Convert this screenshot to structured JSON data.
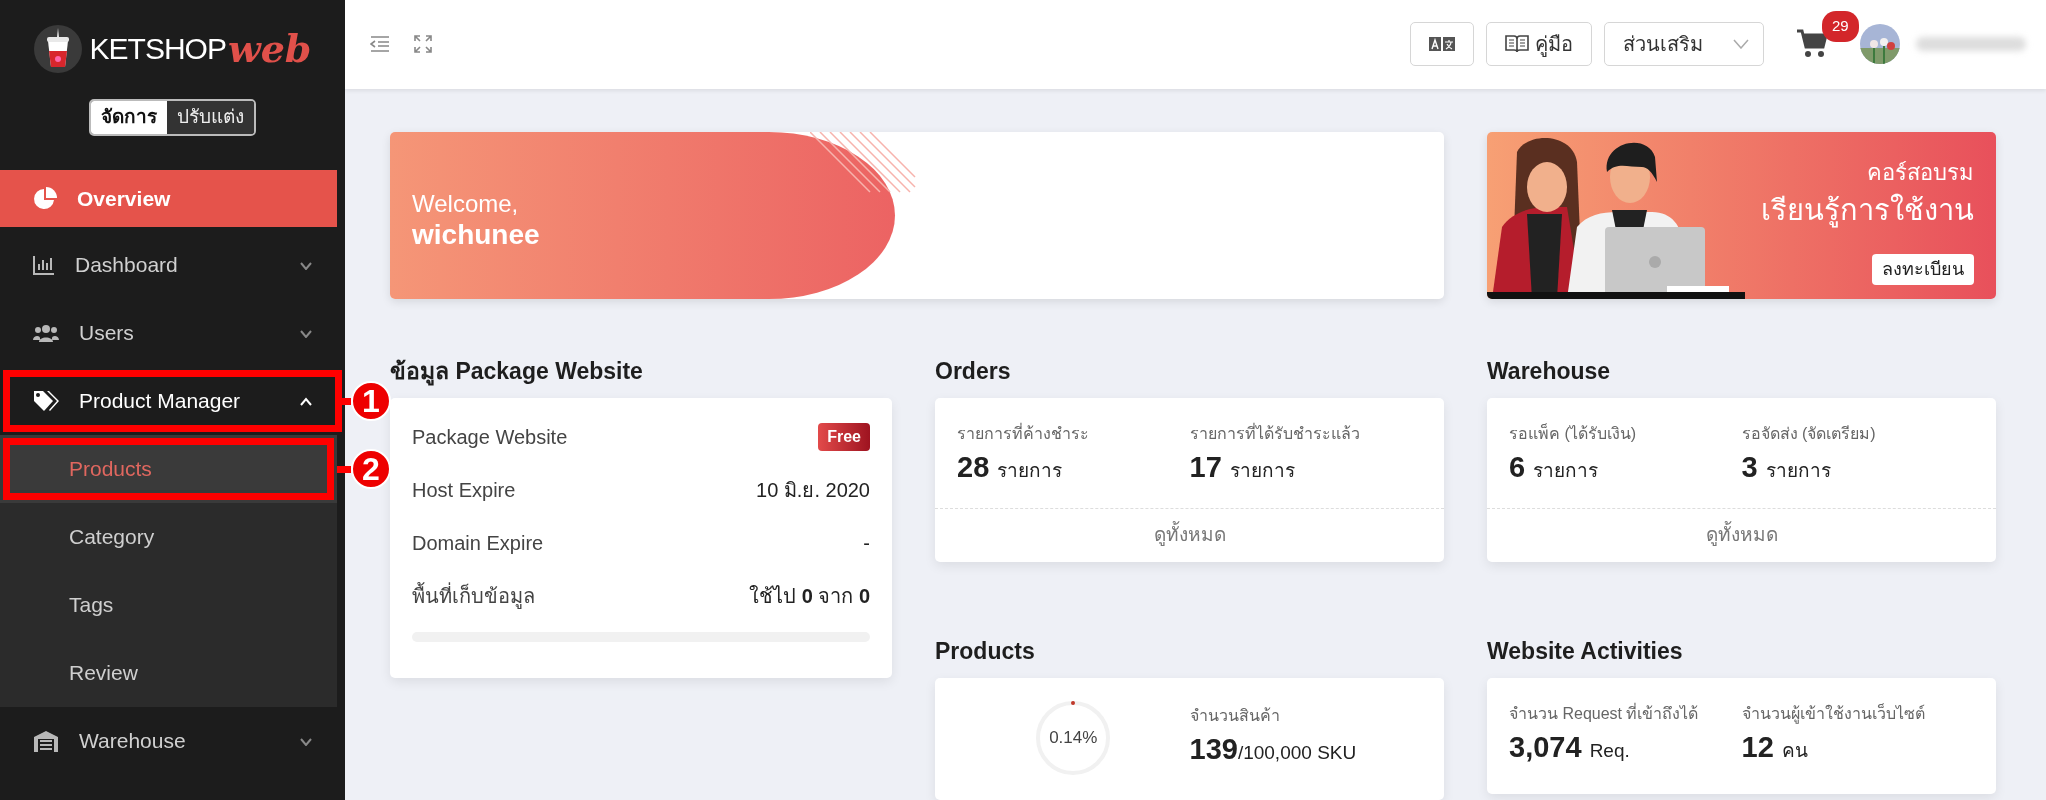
{
  "brand": {
    "name": "KETSHOP",
    "suffix": "web"
  },
  "mode_toggle": [
    {
      "label": "จัดการ",
      "selected": true
    },
    {
      "label": "ปรับแต่ง",
      "selected": false
    }
  ],
  "sidebar": {
    "items": [
      {
        "label": "Overview",
        "kind": "link",
        "selected": true
      },
      {
        "label": "Dashboard",
        "kind": "group",
        "selected": false,
        "expanded": false
      },
      {
        "label": "Users",
        "kind": "group",
        "selected": false,
        "expanded": false
      },
      {
        "label": "Product Manager",
        "kind": "group",
        "selected": false,
        "expanded": true,
        "callout": "1",
        "children": [
          {
            "label": "Products",
            "selected": true,
            "callout": "2"
          },
          {
            "label": "Category",
            "selected": false
          },
          {
            "label": "Tags",
            "selected": false
          },
          {
            "label": "Review",
            "selected": false
          }
        ]
      },
      {
        "label": "Warehouse",
        "kind": "group",
        "selected": false,
        "expanded": false
      }
    ]
  },
  "topbar": {
    "manual_button": "คู่มือ",
    "addons_dropdown": "ส่วนเสริม",
    "cart_count": "29"
  },
  "welcome": {
    "greeting": "Welcome,",
    "name": "wichunee"
  },
  "course_banner": {
    "subtitle": "คอร์สอบรม",
    "title": "เรียนรู้การใช้งาน",
    "button": "ลงทะเบียน"
  },
  "package": {
    "title": "ข้อมูล Package Website",
    "rows": [
      {
        "kind": "badge",
        "label": "Package Website",
        "value": "Free"
      },
      {
        "kind": "text",
        "label": "Host Expire",
        "value": "10 มิ.ย. 2020"
      },
      {
        "kind": "text",
        "label": "Domain Expire",
        "value": "-"
      },
      {
        "kind": "text",
        "label": "พื้นที่เก็บข้อมูล",
        "value": "ใช้ไป **0** จาก **0**"
      }
    ],
    "storage_bar": {
      "level": 0
    }
  },
  "orders": {
    "title": "Orders",
    "stats": [
      {
        "label": "รายการที่ค้างชำระ",
        "value": "28",
        "unit": "รายการ"
      },
      {
        "label": "รายการที่ได้รับชำระแล้ว",
        "value": "17",
        "unit": "รายการ"
      }
    ],
    "footer": "ดูทั้งหมด"
  },
  "warehouse": {
    "title": "Warehouse",
    "stats": [
      {
        "label": "รอแพ็ค (ได้รับเงิน)",
        "value": "6",
        "unit": "รายการ"
      },
      {
        "label": "รอจัดส่ง (จัดเตรียม)",
        "value": "3",
        "unit": "รายการ"
      }
    ],
    "footer": "ดูทั้งหมด"
  },
  "products": {
    "title": "Products",
    "ring_text": "0.14%",
    "level": 0.0014,
    "stat": {
      "label": "จำนวนสินค้า",
      "value": "139",
      "unit": "/100,000 SKU"
    }
  },
  "activities": {
    "title": "Website Activities",
    "stats": [
      {
        "label": "จำนวน Request ที่เข้าถึงได้",
        "value": "3,074",
        "unit": "Req."
      },
      {
        "label": "จำนวนผู้เข้าใช้งานเว็บไซต์",
        "value": "12",
        "unit": "คน"
      }
    ]
  }
}
